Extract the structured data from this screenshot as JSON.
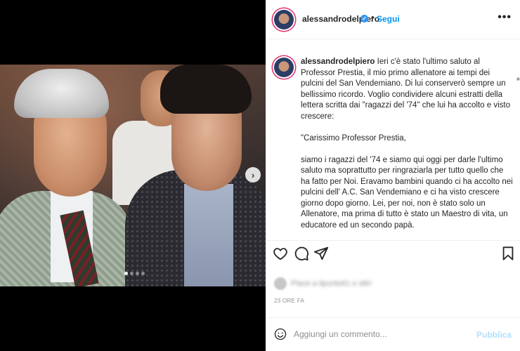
{
  "post": {
    "username": "alessandrodelpiero",
    "follow_label": "Segui",
    "separator": "•",
    "more_icon": "•••"
  },
  "caption": {
    "username": "alessandrodelpiero",
    "p1": "Ieri c'è stato l'ultimo saluto al Professor Prestia, il mio primo allenatore ai tempi dei pulcini del San Vendemiano. Di lui conserverò sempre un bellissimo ricordo. Voglio condividere alcuni estratti della lettera scritta dai \"ragazzi del '74\" che lui ha accolto e visto crescere:",
    "p2": "\"Carissimo Professor Prestia,",
    "p3": "siamo i ragazzi del '74 e siamo qui oggi per darle l'ultimo saluto ma soprattutto per ringraziarla per tutto quello che ha fatto per Noi. Eravamo bambini quando ci ha accolto nei pulcini dell' A.C. San Vendemiano e ci ha visto crescere giorno dopo giorno. Lei, per noi, non è stato solo un Allenatore, ma prima di tutto è stato un Maestro di vita, un educatore ed un secondo papà."
  },
  "likes_text": "Piace a ilpunto61 e altri",
  "timestamp": "23 ORE FA",
  "comment": {
    "placeholder": "Aggiungi un commento...",
    "publish_label": "Pubblica"
  },
  "carousel": {
    "slides": 4,
    "active_index": 0
  },
  "colors": {
    "accent": "#0095f6",
    "verified": "#3897f0",
    "story_ring": "#e1306c"
  },
  "icons": [
    "heart-icon",
    "comment-icon",
    "share-icon",
    "bookmark-icon",
    "emoji-icon",
    "chevron-right-icon",
    "verified-icon",
    "more-icon"
  ]
}
